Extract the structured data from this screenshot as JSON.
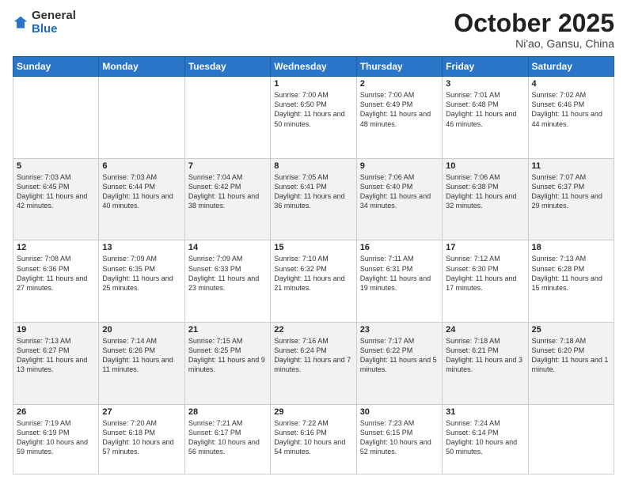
{
  "header": {
    "logo_general": "General",
    "logo_blue": "Blue",
    "month": "October 2025",
    "location": "Ni'ao, Gansu, China"
  },
  "days_of_week": [
    "Sunday",
    "Monday",
    "Tuesday",
    "Wednesday",
    "Thursday",
    "Friday",
    "Saturday"
  ],
  "weeks": [
    [
      {
        "day": "",
        "content": ""
      },
      {
        "day": "",
        "content": ""
      },
      {
        "day": "",
        "content": ""
      },
      {
        "day": "1",
        "content": "Sunrise: 7:00 AM\nSunset: 6:50 PM\nDaylight: 11 hours\nand 50 minutes."
      },
      {
        "day": "2",
        "content": "Sunrise: 7:00 AM\nSunset: 6:49 PM\nDaylight: 11 hours\nand 48 minutes."
      },
      {
        "day": "3",
        "content": "Sunrise: 7:01 AM\nSunset: 6:48 PM\nDaylight: 11 hours\nand 46 minutes."
      },
      {
        "day": "4",
        "content": "Sunrise: 7:02 AM\nSunset: 6:46 PM\nDaylight: 11 hours\nand 44 minutes."
      }
    ],
    [
      {
        "day": "5",
        "content": "Sunrise: 7:03 AM\nSunset: 6:45 PM\nDaylight: 11 hours\nand 42 minutes."
      },
      {
        "day": "6",
        "content": "Sunrise: 7:03 AM\nSunset: 6:44 PM\nDaylight: 11 hours\nand 40 minutes."
      },
      {
        "day": "7",
        "content": "Sunrise: 7:04 AM\nSunset: 6:42 PM\nDaylight: 11 hours\nand 38 minutes."
      },
      {
        "day": "8",
        "content": "Sunrise: 7:05 AM\nSunset: 6:41 PM\nDaylight: 11 hours\nand 36 minutes."
      },
      {
        "day": "9",
        "content": "Sunrise: 7:06 AM\nSunset: 6:40 PM\nDaylight: 11 hours\nand 34 minutes."
      },
      {
        "day": "10",
        "content": "Sunrise: 7:06 AM\nSunset: 6:38 PM\nDaylight: 11 hours\nand 32 minutes."
      },
      {
        "day": "11",
        "content": "Sunrise: 7:07 AM\nSunset: 6:37 PM\nDaylight: 11 hours\nand 29 minutes."
      }
    ],
    [
      {
        "day": "12",
        "content": "Sunrise: 7:08 AM\nSunset: 6:36 PM\nDaylight: 11 hours\nand 27 minutes."
      },
      {
        "day": "13",
        "content": "Sunrise: 7:09 AM\nSunset: 6:35 PM\nDaylight: 11 hours\nand 25 minutes."
      },
      {
        "day": "14",
        "content": "Sunrise: 7:09 AM\nSunset: 6:33 PM\nDaylight: 11 hours\nand 23 minutes."
      },
      {
        "day": "15",
        "content": "Sunrise: 7:10 AM\nSunset: 6:32 PM\nDaylight: 11 hours\nand 21 minutes."
      },
      {
        "day": "16",
        "content": "Sunrise: 7:11 AM\nSunset: 6:31 PM\nDaylight: 11 hours\nand 19 minutes."
      },
      {
        "day": "17",
        "content": "Sunrise: 7:12 AM\nSunset: 6:30 PM\nDaylight: 11 hours\nand 17 minutes."
      },
      {
        "day": "18",
        "content": "Sunrise: 7:13 AM\nSunset: 6:28 PM\nDaylight: 11 hours\nand 15 minutes."
      }
    ],
    [
      {
        "day": "19",
        "content": "Sunrise: 7:13 AM\nSunset: 6:27 PM\nDaylight: 11 hours\nand 13 minutes."
      },
      {
        "day": "20",
        "content": "Sunrise: 7:14 AM\nSunset: 6:26 PM\nDaylight: 11 hours\nand 11 minutes."
      },
      {
        "day": "21",
        "content": "Sunrise: 7:15 AM\nSunset: 6:25 PM\nDaylight: 11 hours\nand 9 minutes."
      },
      {
        "day": "22",
        "content": "Sunrise: 7:16 AM\nSunset: 6:24 PM\nDaylight: 11 hours\nand 7 minutes."
      },
      {
        "day": "23",
        "content": "Sunrise: 7:17 AM\nSunset: 6:22 PM\nDaylight: 11 hours\nand 5 minutes."
      },
      {
        "day": "24",
        "content": "Sunrise: 7:18 AM\nSunset: 6:21 PM\nDaylight: 11 hours\nand 3 minutes."
      },
      {
        "day": "25",
        "content": "Sunrise: 7:18 AM\nSunset: 6:20 PM\nDaylight: 11 hours\nand 1 minute."
      }
    ],
    [
      {
        "day": "26",
        "content": "Sunrise: 7:19 AM\nSunset: 6:19 PM\nDaylight: 10 hours\nand 59 minutes."
      },
      {
        "day": "27",
        "content": "Sunrise: 7:20 AM\nSunset: 6:18 PM\nDaylight: 10 hours\nand 57 minutes."
      },
      {
        "day": "28",
        "content": "Sunrise: 7:21 AM\nSunset: 6:17 PM\nDaylight: 10 hours\nand 56 minutes."
      },
      {
        "day": "29",
        "content": "Sunrise: 7:22 AM\nSunset: 6:16 PM\nDaylight: 10 hours\nand 54 minutes."
      },
      {
        "day": "30",
        "content": "Sunrise: 7:23 AM\nSunset: 6:15 PM\nDaylight: 10 hours\nand 52 minutes."
      },
      {
        "day": "31",
        "content": "Sunrise: 7:24 AM\nSunset: 6:14 PM\nDaylight: 10 hours\nand 50 minutes."
      },
      {
        "day": "",
        "content": ""
      }
    ]
  ]
}
